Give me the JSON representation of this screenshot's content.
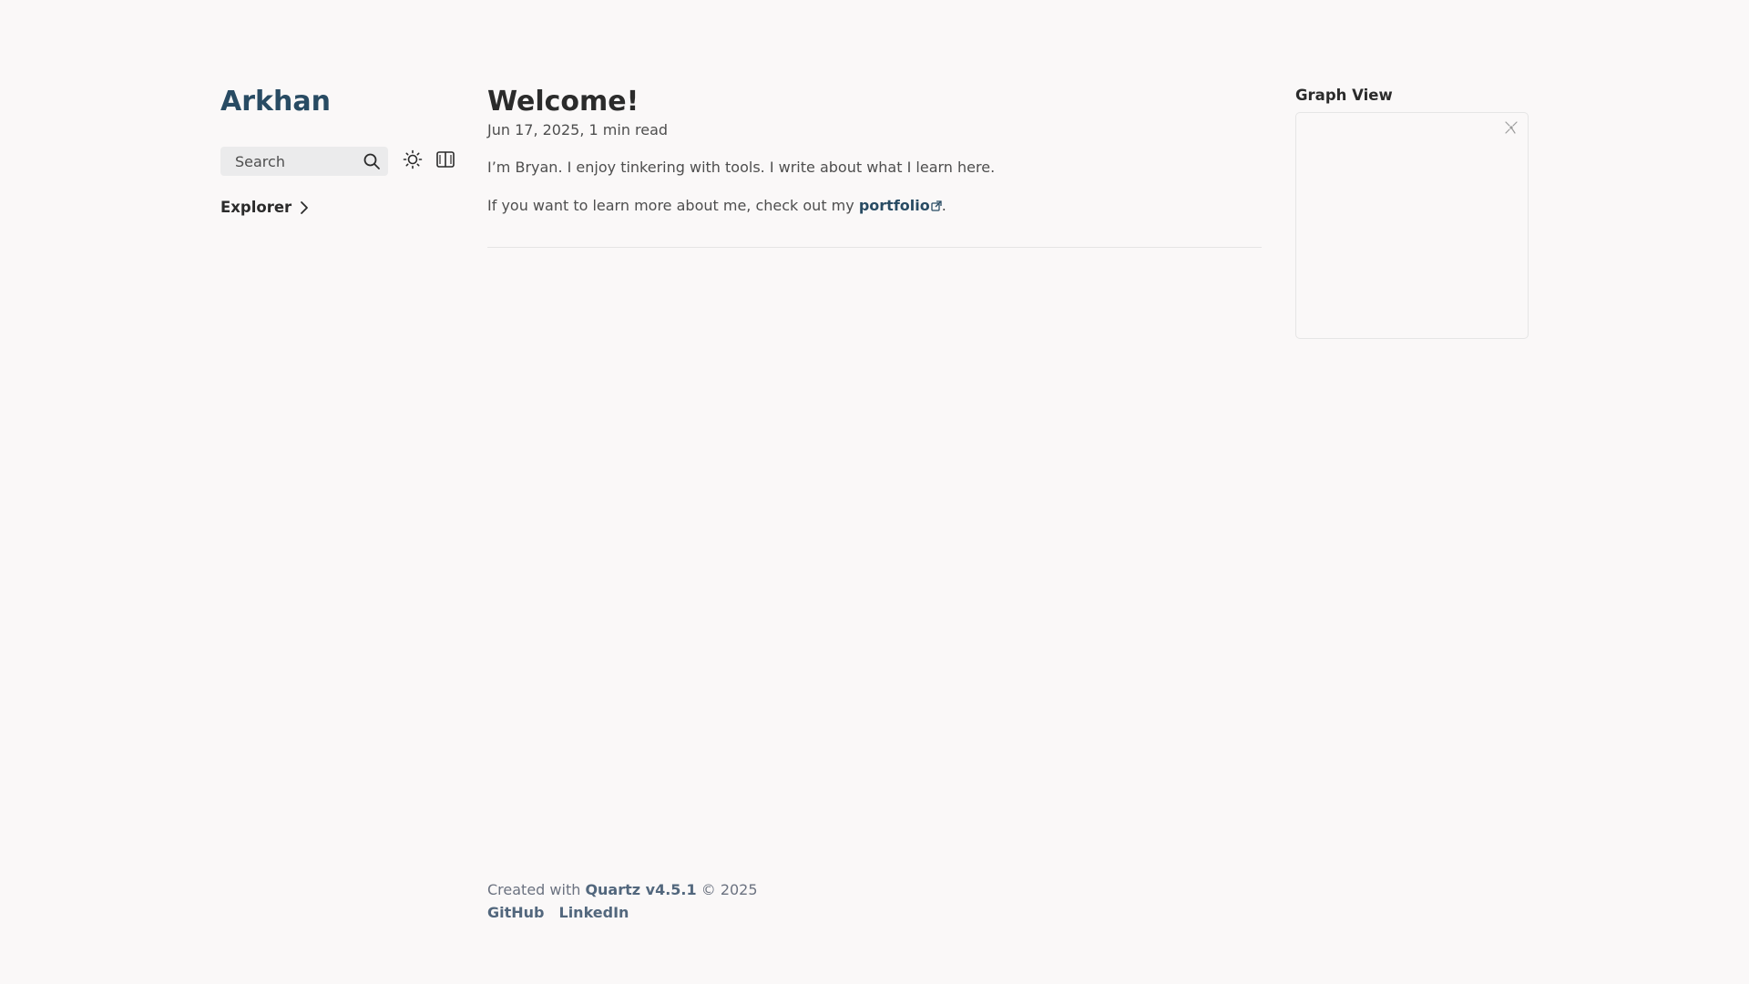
{
  "site": {
    "title": "Arkhan"
  },
  "search": {
    "placeholder": "Search",
    "icon": "search-icon"
  },
  "toolbar": {
    "theme_icon": "sun-icon",
    "reader_icon": "book-icon"
  },
  "explorer": {
    "label": "Explorer",
    "icon": "chevron-right-icon"
  },
  "article": {
    "title": "Welcome!",
    "date": "Jun 17, 2025",
    "separator": ",",
    "read_time": "1 min read",
    "paragraph1": "I’m Bryan. I enjoy tinkering with tools. I write about what I learn here.",
    "paragraph2_prefix": "If you want to learn more about me, check out my ",
    "paragraph2_link": "portfolio",
    "paragraph2_suffix": "."
  },
  "graph": {
    "title": "Graph View",
    "expand_icon": "expand-graph-icon"
  },
  "footer": {
    "created_prefix": "Created with ",
    "quartz_link": "Quartz v4.5.1",
    "copyright": " © 2025",
    "links": [
      "GitHub",
      "LinkedIn"
    ]
  },
  "colors": {
    "background": "#faf8f8",
    "accent": "#284b63",
    "text": "#2b2b2b",
    "muted": "#4e4e4e",
    "footer_link": "#52677d"
  }
}
